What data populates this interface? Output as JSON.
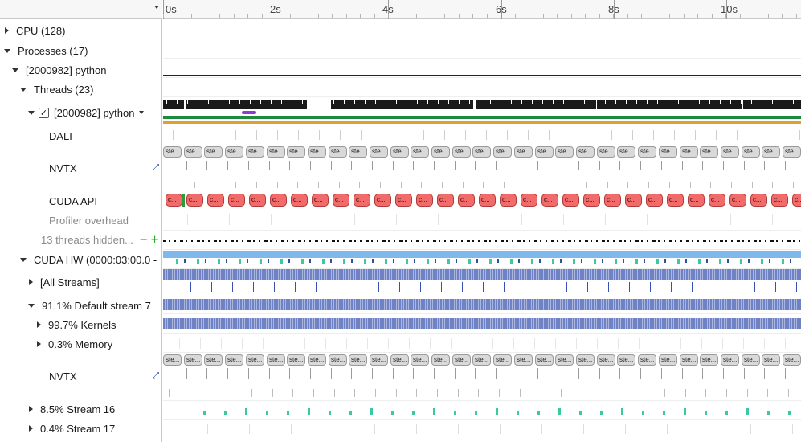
{
  "timeline": {
    "ticks": [
      "0s",
      "2s",
      "4s",
      "6s",
      "8s",
      "10s"
    ]
  },
  "tree": {
    "rows": [
      {
        "key": "cpu",
        "label": "CPU (128)",
        "caret": "right"
      },
      {
        "key": "processes",
        "label": "Processes (17)",
        "caret": "down"
      },
      {
        "key": "process-python",
        "label": "[2000982] python",
        "caret": "down"
      },
      {
        "key": "threads",
        "label": "Threads (23)",
        "caret": "down"
      },
      {
        "key": "thread-python",
        "label": "[2000982] python",
        "caret": "down",
        "checked": true
      },
      {
        "key": "dali",
        "label": "DALI"
      },
      {
        "key": "nvtx",
        "label": "NVTX"
      },
      {
        "key": "cuda-api",
        "label": "CUDA API"
      },
      {
        "key": "profiler-overhead",
        "label": "Profiler overhead"
      },
      {
        "key": "threads-hidden",
        "label": "13 threads hidden..."
      },
      {
        "key": "cuda-hw",
        "label": "CUDA HW (0000:03:00.0 -",
        "caret": "down"
      },
      {
        "key": "all-streams",
        "label": "[All Streams]",
        "caret": "right"
      },
      {
        "key": "default-stream",
        "label": "91.1% Default stream 7",
        "caret": "down"
      },
      {
        "key": "kernels",
        "label": "99.7% Kernels",
        "caret": "right"
      },
      {
        "key": "memory",
        "label": "0.3% Memory",
        "caret": "right"
      },
      {
        "key": "nvtx-gpu",
        "label": "NVTX"
      },
      {
        "key": "stream-16",
        "label": "8.5% Stream 16",
        "caret": "right"
      },
      {
        "key": "stream-17",
        "label": "0.4% Stream 17",
        "caret": "right"
      }
    ]
  },
  "range_labels": {
    "step": "ste...",
    "cuda": "c..."
  },
  "controls": {
    "minus": "−",
    "plus": "+",
    "check": "✓",
    "expand": "⤢"
  },
  "colors": {
    "thread_activity": "#1a1a1a",
    "green_lane": "#1e8a3c",
    "orange_lane": "#e0a030",
    "cuda_api": "#f26b6b",
    "gpu_util": "#7fb8ea",
    "kernels": "#6f83c4",
    "memory": "#3cc8a0",
    "nvtx_highlight": "#8a3fd1"
  }
}
